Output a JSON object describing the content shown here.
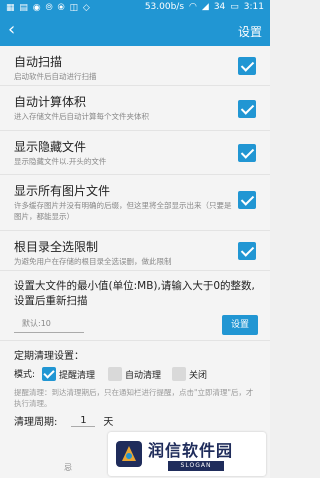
{
  "statusbar": {
    "left": "",
    "net_speed": "53.00b/s",
    "battery": "34",
    "time": "3:11"
  },
  "appbar": {
    "back_icon": "back-arrow-icon",
    "title": "设置"
  },
  "settings": [
    {
      "title": "自动扫描",
      "subtitle": "启动软件后自动进行扫描",
      "checked": true
    },
    {
      "title": "自动计算体积",
      "subtitle": "进入存储文件后自动计算每个文件夹体积",
      "checked": true
    },
    {
      "title": "显示隐藏文件",
      "subtitle": "显示隐藏文件以.开头的文件",
      "checked": true
    },
    {
      "title": "显示所有图片文件",
      "subtitle": "许多缓存图片并没有明确的后缀，但这里将全部显示出来（只要是图片，都能显示）",
      "checked": true
    },
    {
      "title": "根目录全选限制",
      "subtitle": "为避免用户在存储的根目录全选误删，做此限制",
      "checked": true
    }
  ],
  "min_size": {
    "label": "设置大文件的最小值(单位:MB),请输入大于0的整数,设置后重新扫描",
    "input_placeholder": "默认:10",
    "button": "设置"
  },
  "cleanup": {
    "heading": "定期清理设置：",
    "mode_label": "模式:",
    "options": [
      {
        "label": "提醒清理",
        "checked": true
      },
      {
        "label": "自动清理",
        "checked": false
      },
      {
        "label": "关闭",
        "checked": false
      }
    ],
    "note": "提醒清理：到达清理期后，只在通知栏进行提醒，点击\"立即清理\"后，才执行清理。",
    "period_label": "清理周期:",
    "period_value": "1",
    "period_unit": "天"
  },
  "watermark": {
    "name": "润信软件园",
    "slogan": "SLOGAN"
  },
  "bottom_fragment": "忌"
}
